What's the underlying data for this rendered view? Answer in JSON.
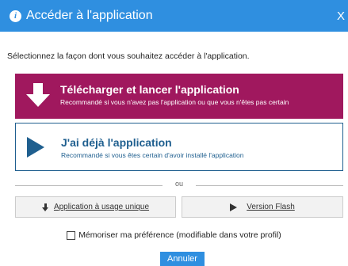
{
  "dialog": {
    "title": "Accéder à l'application",
    "close_glyph": "X",
    "instruction": "Sélectionnez la façon dont vous souhaitez accéder à l'application."
  },
  "options": [
    {
      "title": "Télécharger et lancer l'application",
      "description": "Recommandé si vous n'avez pas l'application ou que vous n'êtes pas certain",
      "icon": "download-arrow-icon",
      "color": "#a0185e"
    },
    {
      "title": "J'ai déjà l'application",
      "description": "Recommandé si vous êtes certain d'avoir installé l'application",
      "icon": "play-icon",
      "color": "#1f5f8f"
    }
  ],
  "separator": {
    "label": "ou"
  },
  "alternatives": [
    {
      "label": "Application à usage unique",
      "icon": "download-icon"
    },
    {
      "label": "Version Flash",
      "icon": "play-icon"
    }
  ],
  "remember": {
    "label": "Mémoriser ma préférence (modifiable dans votre profil)",
    "checked": false
  },
  "cancel_label": "Annuler",
  "colors": {
    "accent": "#2f8fe0",
    "primary_option": "#a0185e",
    "secondary_option": "#1f5f8f"
  }
}
